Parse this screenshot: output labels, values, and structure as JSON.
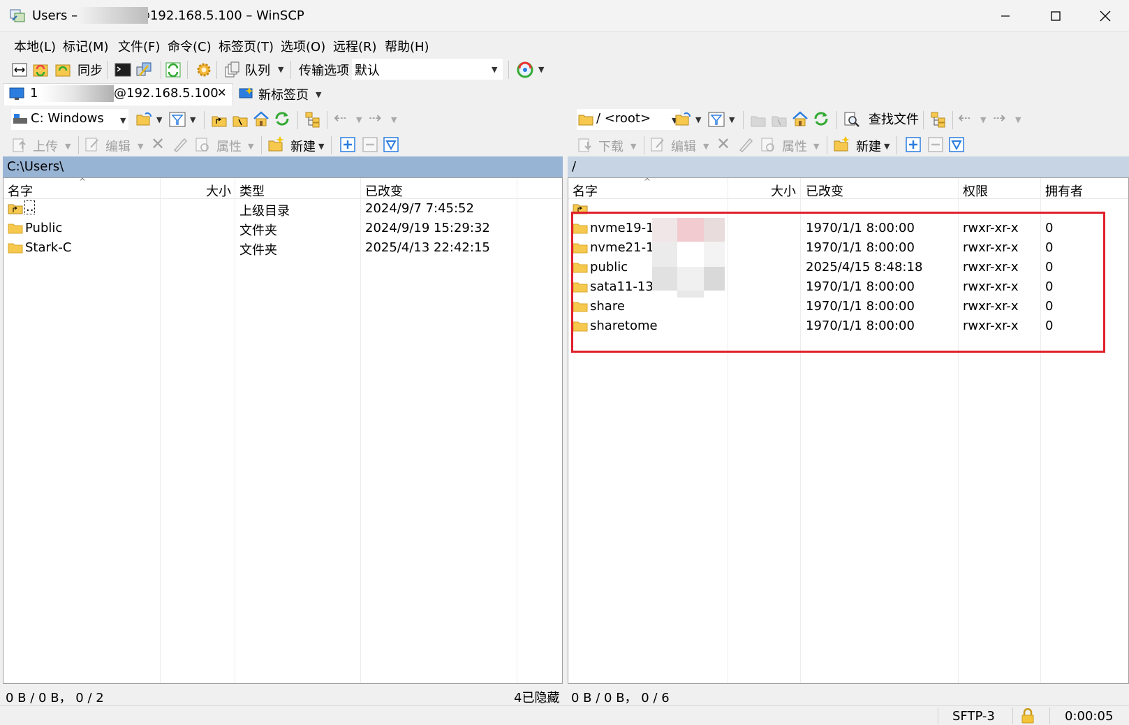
{
  "window": {
    "title": "Users – 1            @192.168.5.100 – WinSCP"
  },
  "menu": [
    "本地(L)",
    "标记(M)",
    "文件(F)",
    "命令(C)",
    "标签页(T)",
    "选项(O)",
    "远程(R)",
    "帮助(H)"
  ],
  "toolbar": {
    "sync_label": "同步",
    "queue_label": "队列",
    "transfer_options_label": "传输选项",
    "transfer_preset_value": "默认"
  },
  "tabs": {
    "session_prefix": "1",
    "session_host": "@192.168.5.100",
    "new_tab_label": "新标签页"
  },
  "left": {
    "drive_value": "C: Windows",
    "upload_label": "上传",
    "edit_label": "编辑",
    "properties_label": "属性",
    "new_label": "新建",
    "path": "C:\\Users\\",
    "columns": {
      "name": "名字",
      "size": "大小",
      "type": "类型",
      "changed": "已改变"
    },
    "rows": [
      {
        "name": "..",
        "type": "上级目录",
        "changed": "2024/9/7  7:45:52"
      },
      {
        "name": "Public",
        "type": "文件夹",
        "changed": "2024/9/19  15:29:32"
      },
      {
        "name": "Stark-C",
        "type": "文件夹",
        "changed": "2025/4/13  22:42:15"
      }
    ],
    "status_left": "0 B / 0 B，  0 / 2",
    "status_right": "4已隐藏"
  },
  "right": {
    "dir_value": "/ <root>",
    "find_files_label": "查找文件",
    "download_label": "下载",
    "edit_label": "编辑",
    "properties_label": "属性",
    "new_label": "新建",
    "path": "/",
    "columns": {
      "name": "名字",
      "size": "大小",
      "changed": "已改变",
      "rights": "权限",
      "owner": "拥有者"
    },
    "rows": [
      {
        "name": "nvme19-1",
        "changed": "1970/1/1  8:00:00",
        "rights": "rwxr-xr-x",
        "owner": "0"
      },
      {
        "name": "nvme21-1",
        "changed": "1970/1/1  8:00:00",
        "rights": "rwxr-xr-x",
        "owner": "0"
      },
      {
        "name": "public",
        "changed": "2025/4/15  8:48:18",
        "rights": "rwxr-xr-x",
        "owner": "0"
      },
      {
        "name": "sata11-13",
        "changed": "1970/1/1  8:00:00",
        "rights": "rwxr-xr-x",
        "owner": "0"
      },
      {
        "name": "share",
        "changed": "1970/1/1  8:00:00",
        "rights": "rwxr-xr-x",
        "owner": "0"
      },
      {
        "name": "sharetome",
        "changed": "1970/1/1  8:00:00",
        "rights": "rwxr-xr-x",
        "owner": "0"
      }
    ],
    "status_left": "0 B / 0 B，  0 / 6"
  },
  "statusbar": {
    "protocol": "SFTP-3",
    "elapsed": "0:00:05"
  },
  "colors": {
    "active_path_bg": "#98b4d4",
    "inactive_path_bg": "#c6d4e3",
    "highlight_box": "#e0202c",
    "folder_yellow": "#f6c94e"
  }
}
